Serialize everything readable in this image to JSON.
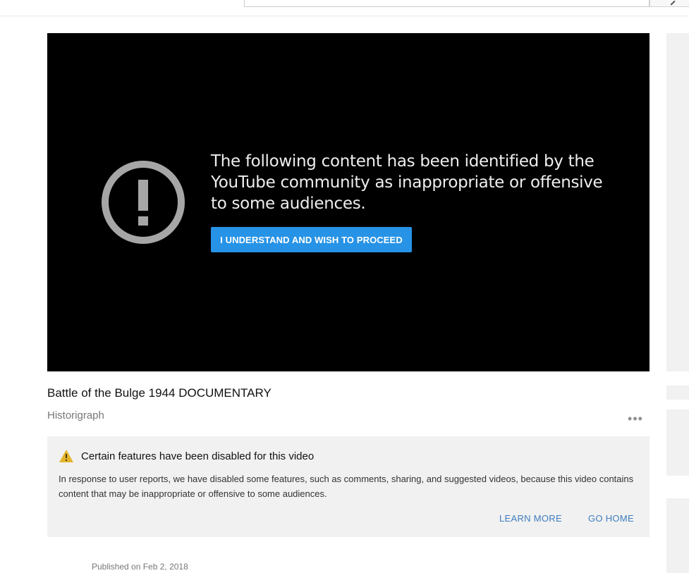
{
  "player": {
    "warning_message": "The following content has been identified by the YouTube community as inappropriate or offensive to some audiences.",
    "proceed_label": "I UNDERSTAND AND WISH TO PROCEED",
    "proceed_color": "#2793e6",
    "icon": "exclamation-circle-icon"
  },
  "video": {
    "title": "Battle of the Bulge 1944 DOCUMENTARY",
    "channel": "Historigraph",
    "more_label": "•••",
    "published": "Published on Feb 2, 2018"
  },
  "notice": {
    "icon": "warning-triangle-icon",
    "icon_color": "#e3b42b",
    "title": "Certain features have been disabled for this video",
    "body": "In response to user reports, we have disabled some features, such as comments, sharing, and suggested videos, because this video contains content that may be inappropriate or offensive to some audiences.",
    "learn_more": "LEARN MORE",
    "go_home": "GO HOME",
    "link_color": "#3e7dc0"
  },
  "header": {
    "search_icon": "search-icon"
  }
}
